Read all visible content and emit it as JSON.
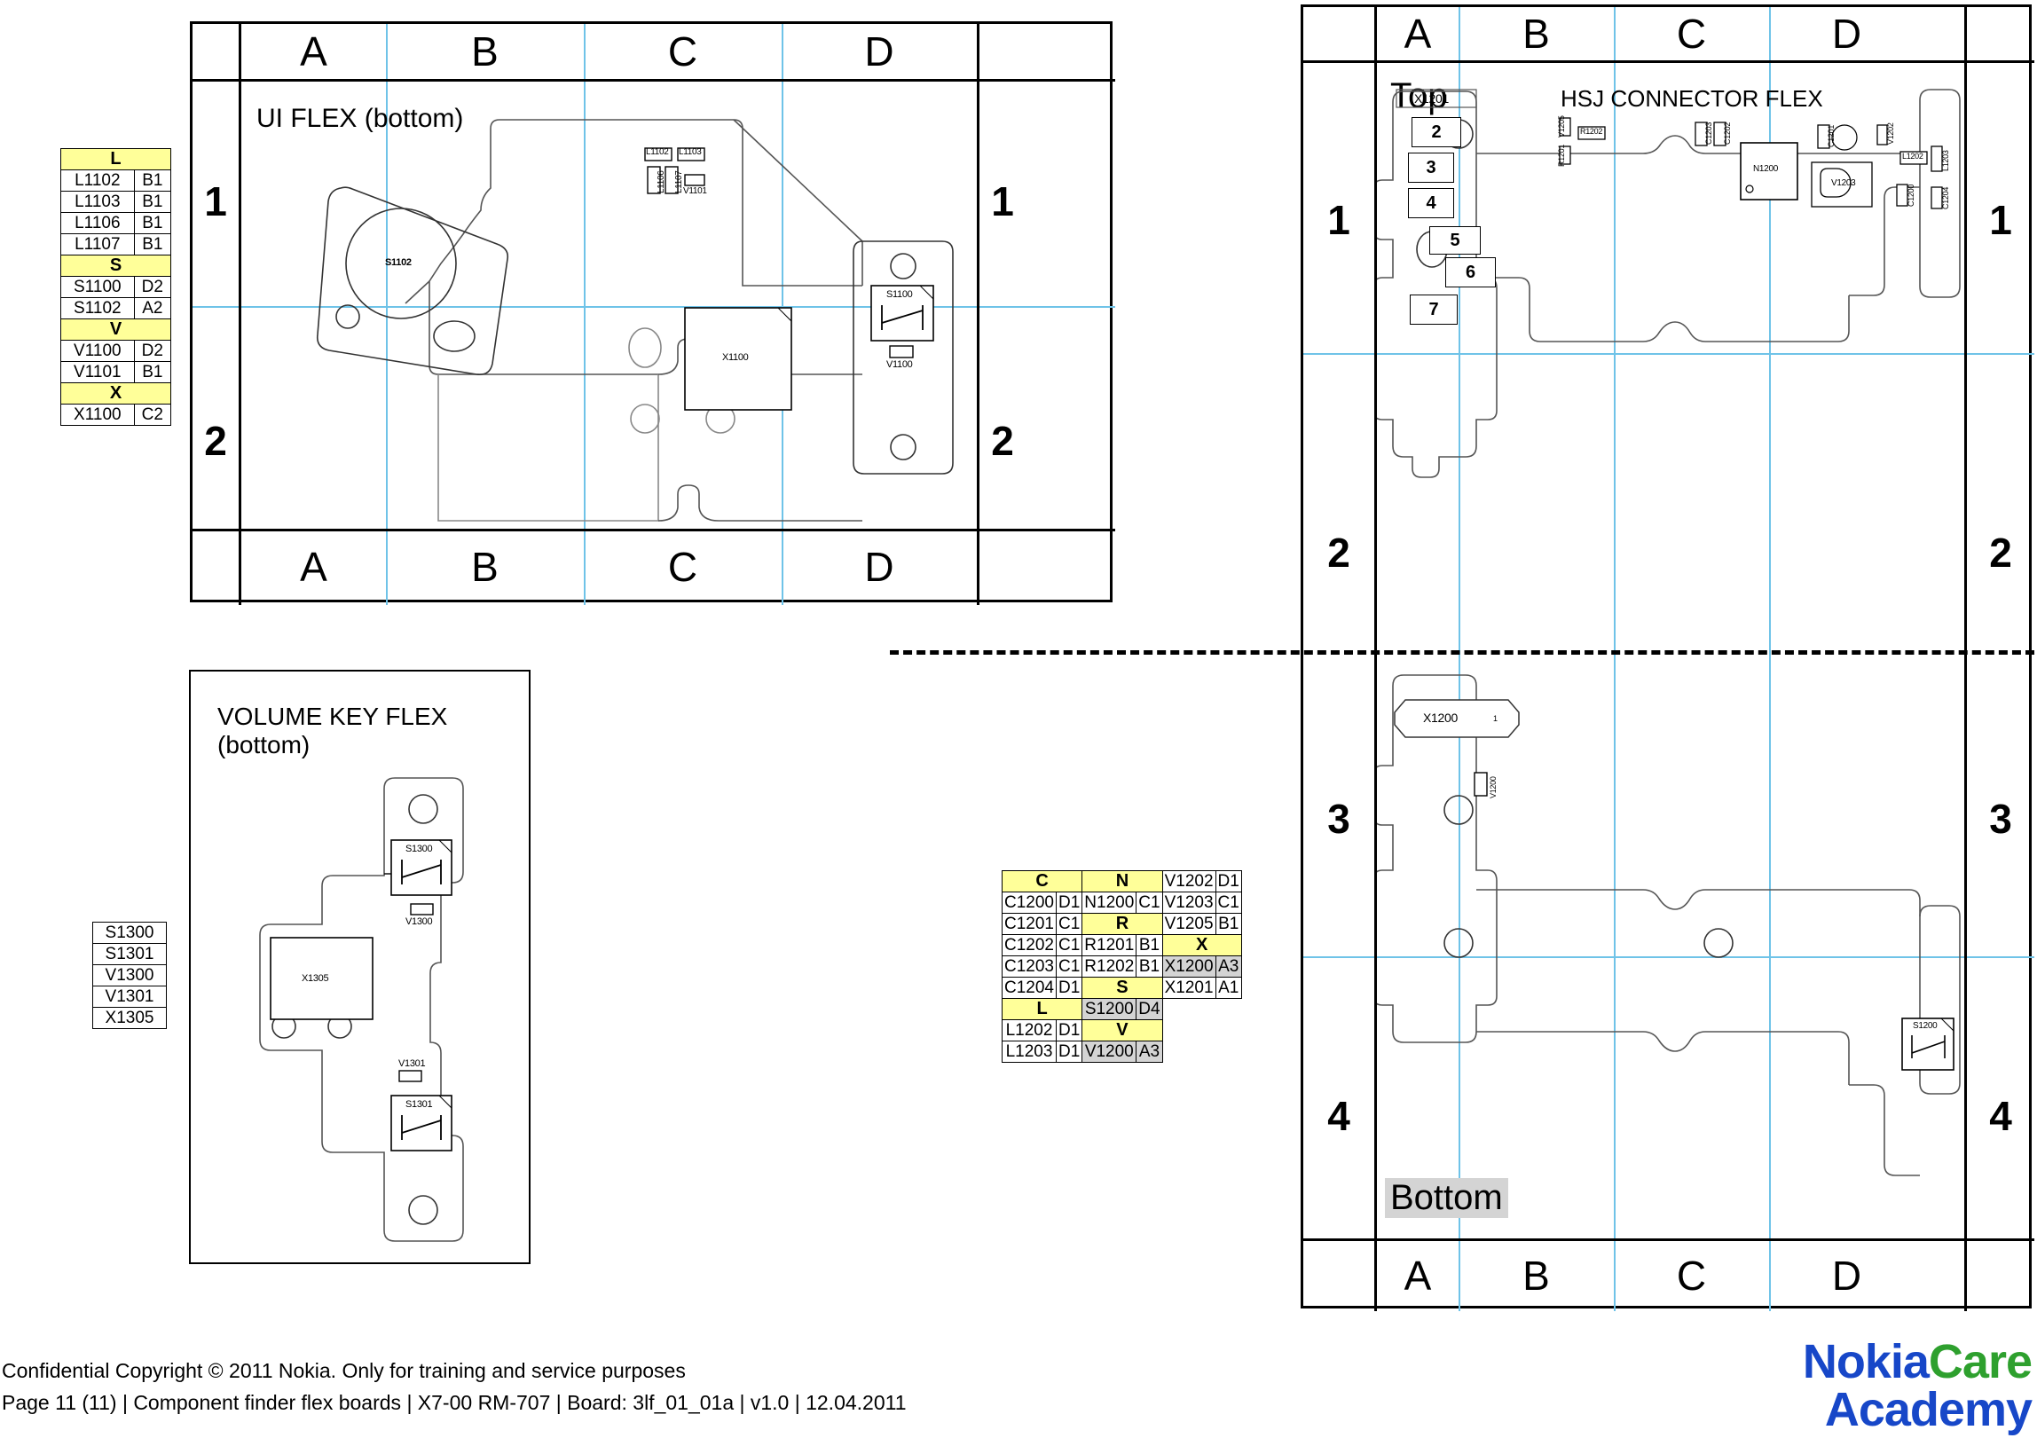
{
  "document": {
    "footer_line1": "Confidential Copyright © 2011 Nokia. Only for training and service purposes",
    "footer_line2": "Page 11 (11)  |  Component finder flex boards  |  X7-00 RM-707  |  Board: 3lf_01_01a |  v1.0  |  12.04.2011",
    "logo": {
      "word1": "Nokia",
      "word2": "Care",
      "word3": "Academy",
      "color_blue": "#1747c8",
      "color_green": "#2ea02e"
    }
  },
  "colors": {
    "header_yellow": "#ffff99",
    "gray_cell": "#d4d4d4",
    "grid_blue": "#6fc3e8"
  },
  "ui_flex_panel": {
    "title": "UI FLEX (bottom)",
    "col_headers_top": [
      "A",
      "B",
      "C",
      "D"
    ],
    "col_headers_bottom": [
      "A",
      "B",
      "C",
      "D"
    ],
    "row_headers_left": [
      "1",
      "2"
    ],
    "row_headers_right": [
      "1",
      "2"
    ],
    "components": [
      {
        "label": "L1102"
      },
      {
        "label": "L1103"
      },
      {
        "label": "L1106"
      },
      {
        "label": "L1107"
      },
      {
        "label": "V1101"
      },
      {
        "label": "S1102"
      },
      {
        "label": "X1100"
      },
      {
        "label": "S1100"
      },
      {
        "label": "V1100"
      }
    ]
  },
  "ui_flex_table": {
    "groups": [
      {
        "header": "L",
        "rows": [
          {
            "ref": "L1102",
            "loc": "B1"
          },
          {
            "ref": "L1103",
            "loc": "B1"
          },
          {
            "ref": "L1106",
            "loc": "B1"
          },
          {
            "ref": "L1107",
            "loc": "B1"
          }
        ]
      },
      {
        "header": "S",
        "rows": [
          {
            "ref": "S1100",
            "loc": "D2"
          },
          {
            "ref": "S1102",
            "loc": "A2"
          }
        ]
      },
      {
        "header": "V",
        "rows": [
          {
            "ref": "V1100",
            "loc": "D2"
          },
          {
            "ref": "V1101",
            "loc": "B1"
          }
        ]
      },
      {
        "header": "X",
        "rows": [
          {
            "ref": "X1100",
            "loc": "C2"
          }
        ]
      }
    ]
  },
  "volume_key_panel": {
    "title": "VOLUME KEY FLEX (bottom)",
    "components": [
      {
        "label": "S1300"
      },
      {
        "label": "V1300"
      },
      {
        "label": "X1305"
      },
      {
        "label": "V1301"
      },
      {
        "label": "S1301"
      }
    ]
  },
  "volume_key_table": {
    "rows": [
      "S1300",
      "S1301",
      "V1300",
      "V1301",
      "X1305"
    ]
  },
  "hsj_table": {
    "col1": [
      {
        "text": "C",
        "type": "hdr",
        "span": 2
      },
      {
        "ref": "C1200",
        "loc": "D1"
      },
      {
        "ref": "C1201",
        "loc": "C1"
      },
      {
        "ref": "C1202",
        "loc": "C1"
      },
      {
        "ref": "C1203",
        "loc": "C1"
      },
      {
        "ref": "C1204",
        "loc": "D1"
      },
      {
        "text": "L",
        "type": "hdr",
        "span": 2
      },
      {
        "ref": "L1202",
        "loc": "D1"
      },
      {
        "ref": "L1203",
        "loc": "D1"
      }
    ],
    "col2": [
      {
        "text": "N",
        "type": "hdr",
        "span": 2
      },
      {
        "ref": "N1200",
        "loc": "C1"
      },
      {
        "text": "R",
        "type": "hdr",
        "span": 2
      },
      {
        "ref": "R1201",
        "loc": "B1"
      },
      {
        "ref": "R1202",
        "loc": "B1"
      },
      {
        "text": "S",
        "type": "hdr",
        "span": 2
      },
      {
        "ref": "S1200",
        "loc": "D4",
        "style": "gray"
      },
      {
        "text": "V",
        "type": "hdr",
        "span": 2
      },
      {
        "ref": "V1200",
        "loc": "A3",
        "style": "gray"
      }
    ],
    "col3": [
      {
        "ref": "V1202",
        "loc": "D1"
      },
      {
        "ref": "V1203",
        "loc": "C1"
      },
      {
        "ref": "V1205",
        "loc": "B1"
      },
      {
        "text": "X",
        "type": "hdr",
        "span": 2
      },
      {
        "ref": "X1200",
        "loc": "A3",
        "style": "gray"
      },
      {
        "ref": "X1201",
        "loc": "A1"
      }
    ]
  },
  "hsj_panel": {
    "title": "HSJ CONNECTOR FLEX",
    "side_top": "Top",
    "side_bottom": "Bottom",
    "col_headers_top": [
      "A",
      "B",
      "C",
      "D"
    ],
    "col_headers_bottom": [
      "A",
      "B",
      "C",
      "D"
    ],
    "row_headers_left": [
      "1",
      "2",
      "3",
      "4"
    ],
    "row_headers_right": [
      "1",
      "2",
      "3",
      "4"
    ],
    "connector_top": "X1201",
    "connector_bottom": "X1200",
    "connector_bottom_pin": "1",
    "pads": [
      "2",
      "3",
      "4",
      "5",
      "6",
      "7"
    ],
    "components_top": [
      {
        "label": "V1205"
      },
      {
        "label": "R1201"
      },
      {
        "label": "R1202"
      },
      {
        "label": "C1203"
      },
      {
        "label": "C1202"
      },
      {
        "label": "N1200"
      },
      {
        "label": "C1201"
      },
      {
        "label": "V1202"
      },
      {
        "label": "V1203"
      },
      {
        "label": "L1202"
      },
      {
        "label": "L1203"
      },
      {
        "label": "C1200"
      },
      {
        "label": "C1204"
      }
    ],
    "components_bottom": [
      {
        "label": "V1200"
      },
      {
        "label": "S1200"
      }
    ]
  }
}
